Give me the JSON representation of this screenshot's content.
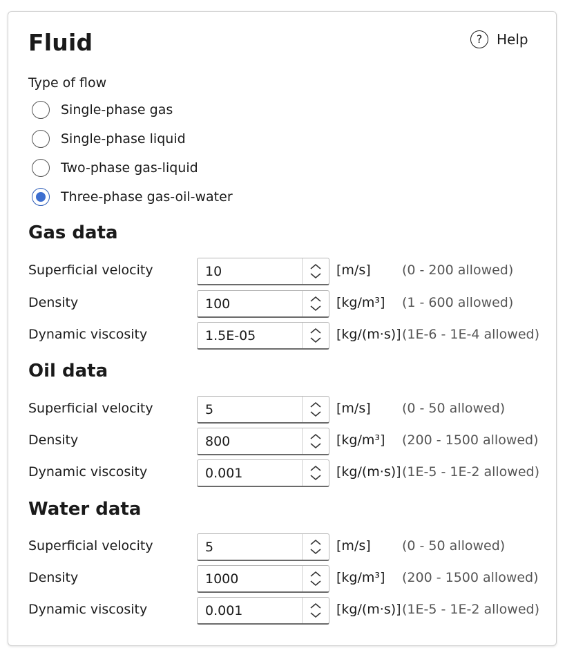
{
  "header": {
    "title": "Fluid",
    "help_label": "Help"
  },
  "flow": {
    "label": "Type of flow",
    "options": [
      {
        "label": "Single-phase gas",
        "selected": false
      },
      {
        "label": "Single-phase liquid",
        "selected": false
      },
      {
        "label": "Two-phase gas-liquid",
        "selected": false
      },
      {
        "label": "Three-phase gas-oil-water",
        "selected": true
      }
    ]
  },
  "sections": {
    "gas": {
      "title": "Gas data",
      "fields": [
        {
          "label": "Superficial velocity",
          "value": "10",
          "unit": "[m/s]",
          "range": "(0 - 200 allowed)"
        },
        {
          "label": "Density",
          "value": "100",
          "unit": "[kg/m³]",
          "range": "(1 - 600 allowed)"
        },
        {
          "label": "Dynamic viscosity",
          "value": "1.5E-05",
          "unit": "[kg/(m·s)]",
          "range": "(1E-6 - 1E-4 allowed)"
        }
      ]
    },
    "oil": {
      "title": "Oil data",
      "fields": [
        {
          "label": "Superficial velocity",
          "value": "5",
          "unit": "[m/s]",
          "range": "(0 - 50 allowed)"
        },
        {
          "label": "Density",
          "value": "800",
          "unit": "[kg/m³]",
          "range": "(200 - 1500 allowed)"
        },
        {
          "label": "Dynamic viscosity",
          "value": "0.001",
          "unit": "[kg/(m·s)]",
          "range": "(1E-5 - 1E-2 allowed)"
        }
      ]
    },
    "water": {
      "title": "Water data",
      "fields": [
        {
          "label": "Superficial velocity",
          "value": "5",
          "unit": "[m/s]",
          "range": "(0 - 50 allowed)"
        },
        {
          "label": "Density",
          "value": "1000",
          "unit": "[kg/m³]",
          "range": "(200 - 1500 allowed)"
        },
        {
          "label": "Dynamic viscosity",
          "value": "0.001",
          "unit": "[kg/(m·s)]",
          "range": "(1E-5 - 1E-2 allowed)"
        }
      ]
    }
  },
  "colors": {
    "accent": "#3c6ed0",
    "border": "#d0d0d0"
  },
  "icons": {
    "help": "question-circle-icon",
    "spin_up": "chevron-up-icon",
    "spin_down": "chevron-down-icon"
  }
}
